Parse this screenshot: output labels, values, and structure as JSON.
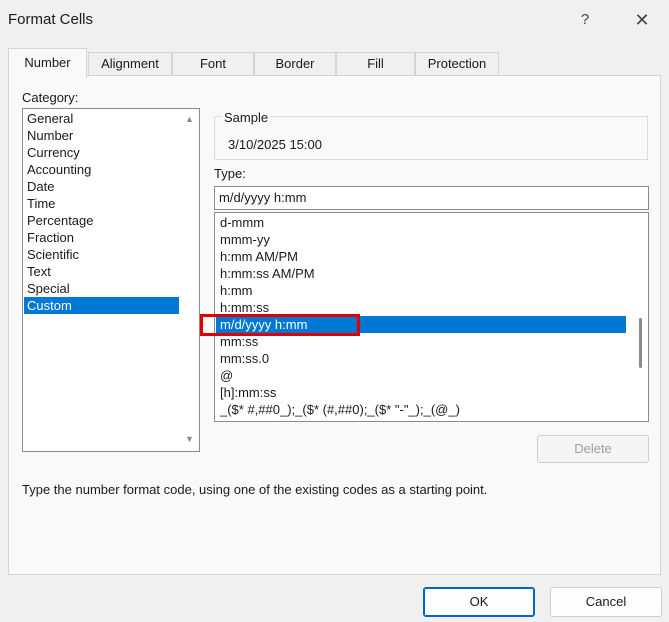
{
  "window": {
    "title": "Format Cells",
    "help": "?",
    "close": "✕"
  },
  "tabs": [
    "Number",
    "Alignment",
    "Font",
    "Border",
    "Fill",
    "Protection"
  ],
  "category": {
    "label": "Category:",
    "items": [
      "General",
      "Number",
      "Currency",
      "Accounting",
      "Date",
      "Time",
      "Percentage",
      "Fraction",
      "Scientific",
      "Text",
      "Special",
      "Custom"
    ],
    "selected": "Custom"
  },
  "sample": {
    "label": "Sample",
    "value": "3/10/2025 15:00"
  },
  "type": {
    "label": "Type:",
    "value": "m/d/yyyy h:mm",
    "items": [
      "d-mmm",
      "mmm-yy",
      "h:mm AM/PM",
      "h:mm:ss AM/PM",
      "h:mm",
      "h:mm:ss",
      "m/d/yyyy h:mm",
      "mm:ss",
      "mm:ss.0",
      "@",
      "[h]:mm:ss",
      "_($* #,##0_);_($* (#,##0);_($* \"-\"_);_(@_)"
    ],
    "selected": "m/d/yyyy h:mm"
  },
  "buttons": {
    "delete": "Delete",
    "ok": "OK",
    "cancel": "Cancel"
  },
  "hint": "Type the number format code, using one of the existing codes as a starting point.",
  "colors": {
    "selection": "#0078d4",
    "highlight": "#e00000",
    "ok_border": "#0067c0"
  }
}
